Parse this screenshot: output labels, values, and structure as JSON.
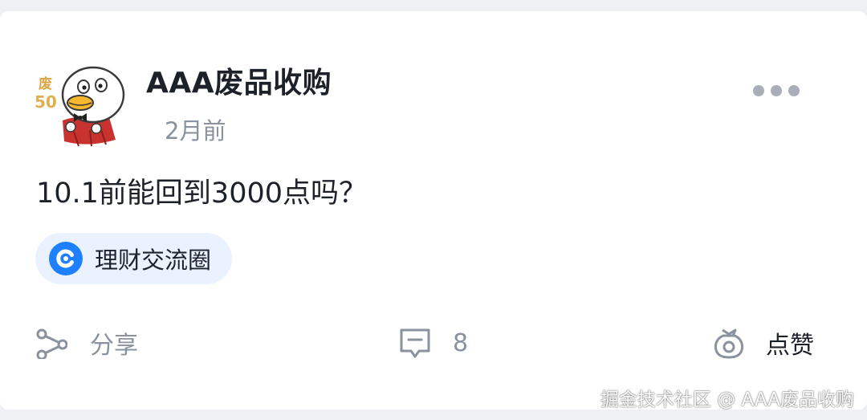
{
  "post": {
    "author": {
      "name": "AAA废品收购",
      "avatar_icon": "duck-mascot-icon",
      "avatar_badge": "废",
      "avatar_level": "50"
    },
    "time": "2月前",
    "content": "10.1前能回到3000点吗？",
    "circle": {
      "icon": "juejin-circle-icon",
      "label": "理财交流圈"
    }
  },
  "actions": {
    "share_label": "分享",
    "comment_count": "8",
    "like_label": "点赞"
  },
  "watermark": "掘金技术社区 @ AAA废品收购",
  "colors": {
    "accent": "#1e80ff",
    "tag_bg": "#eaf2ff",
    "text_primary": "#1d2129",
    "text_secondary": "#8a919f",
    "page_bg": "#eef0f3"
  }
}
